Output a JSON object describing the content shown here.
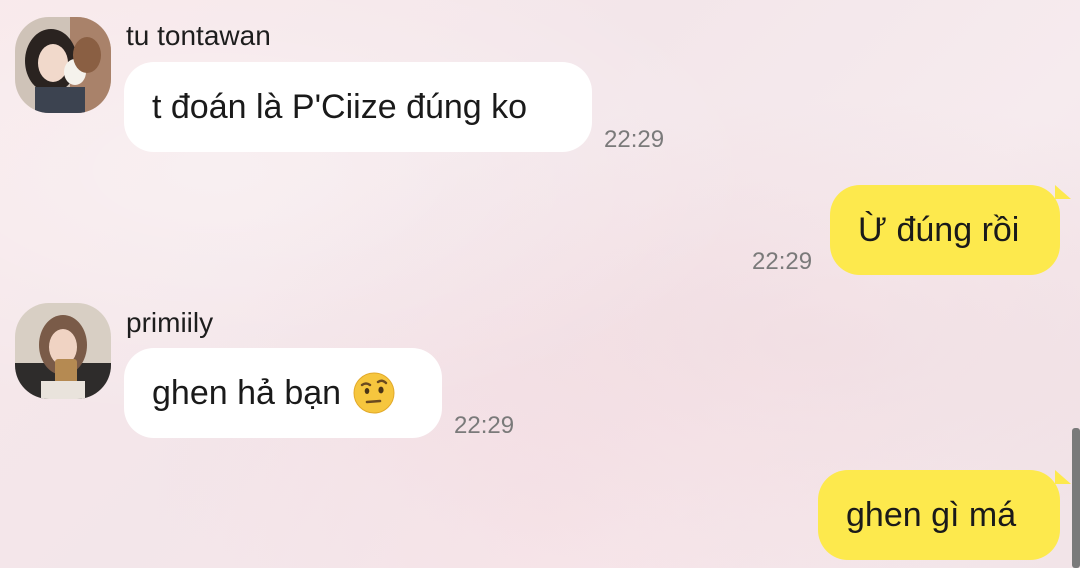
{
  "messages": [
    {
      "sender": "tu tontawan",
      "text": "t đoán là P'Ciize đúng ko",
      "time": "22:29",
      "direction": "incoming",
      "avatar_icon": "profile-photo"
    },
    {
      "text": "Ừ đúng rồi",
      "time": "22:29",
      "direction": "outgoing"
    },
    {
      "sender": "primiily",
      "text": "ghen hả bạn",
      "emoji": "face-with-raised-eyebrow",
      "time": "22:29",
      "direction": "incoming",
      "avatar_icon": "profile-photo"
    },
    {
      "text": "ghen gì má",
      "direction": "outgoing"
    }
  ],
  "colors": {
    "outgoing_bubble": "#fde94d",
    "incoming_bubble": "#ffffff",
    "background": "#f6e8eb",
    "timestamp": "#7a7a7a"
  }
}
